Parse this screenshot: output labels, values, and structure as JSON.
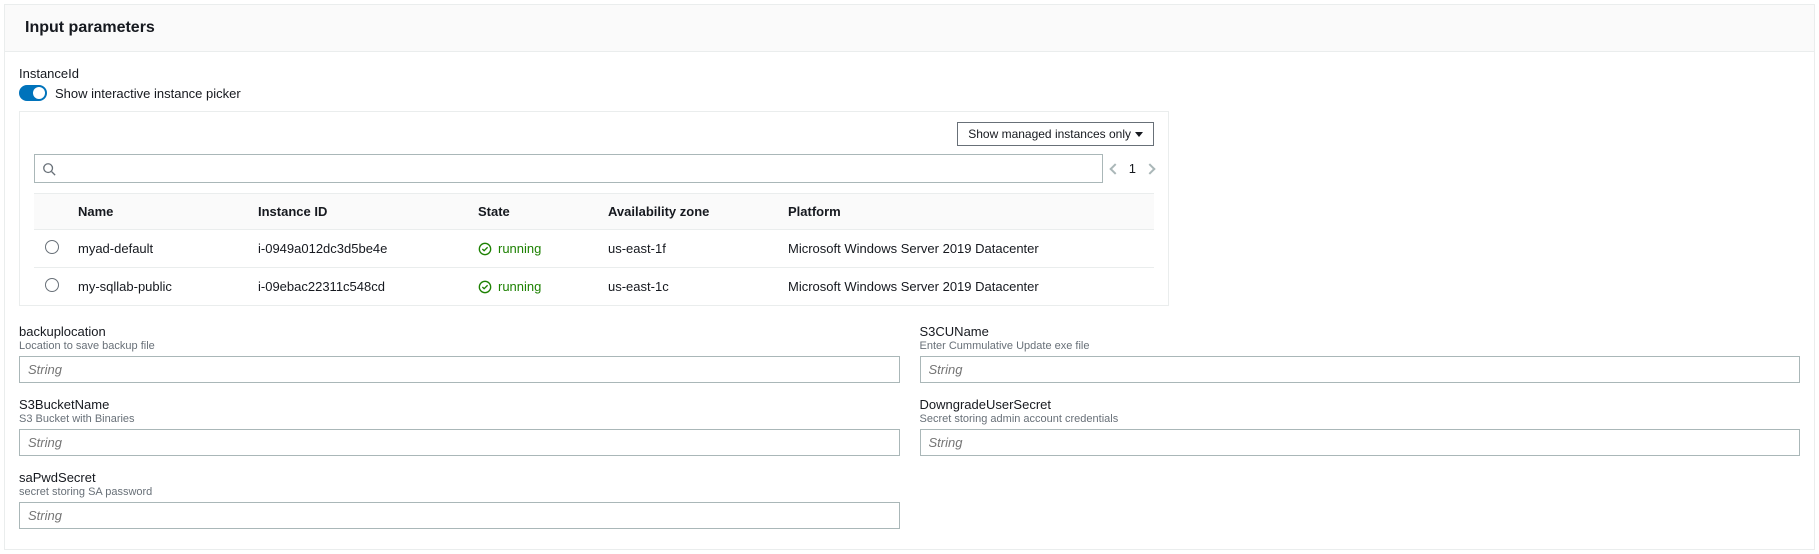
{
  "header": {
    "title": "Input parameters"
  },
  "instanceParam": {
    "label": "InstanceId",
    "toggleLabel": "Show interactive instance picker",
    "filterButton": "Show managed instances only",
    "searchPlaceholder": "",
    "page": "1",
    "columns": {
      "name": "Name",
      "instanceId": "Instance ID",
      "state": "State",
      "az": "Availability zone",
      "platform": "Platform"
    },
    "rows": [
      {
        "name": "myad-default",
        "instanceId": "i-0949a012dc3d5be4e",
        "state": "running",
        "az": "us-east-1f",
        "platform": "Microsoft Windows Server 2019 Datacenter"
      },
      {
        "name": "my-sqllab-public",
        "instanceId": "i-09ebac22311c548cd",
        "state": "running",
        "az": "us-east-1c",
        "platform": "Microsoft Windows Server 2019 Datacenter"
      }
    ]
  },
  "leftParams": [
    {
      "key": "backuplocation",
      "label": "backuplocation",
      "desc": "Location to save backup file",
      "placeholder": "String"
    },
    {
      "key": "s3bucketname",
      "label": "S3BucketName",
      "desc": "S3 Bucket with Binaries",
      "placeholder": "String"
    },
    {
      "key": "sapwdsecret",
      "label": "saPwdSecret",
      "desc": "secret storing SA password",
      "placeholder": "String"
    }
  ],
  "rightParams": [
    {
      "key": "s3cuname",
      "label": "S3CUName",
      "desc": "Enter Cummulative Update exe file",
      "placeholder": "String"
    },
    {
      "key": "downgradeusersecret",
      "label": "DowngradeUserSecret",
      "desc": "Secret storing admin account credentials",
      "placeholder": "String"
    }
  ]
}
